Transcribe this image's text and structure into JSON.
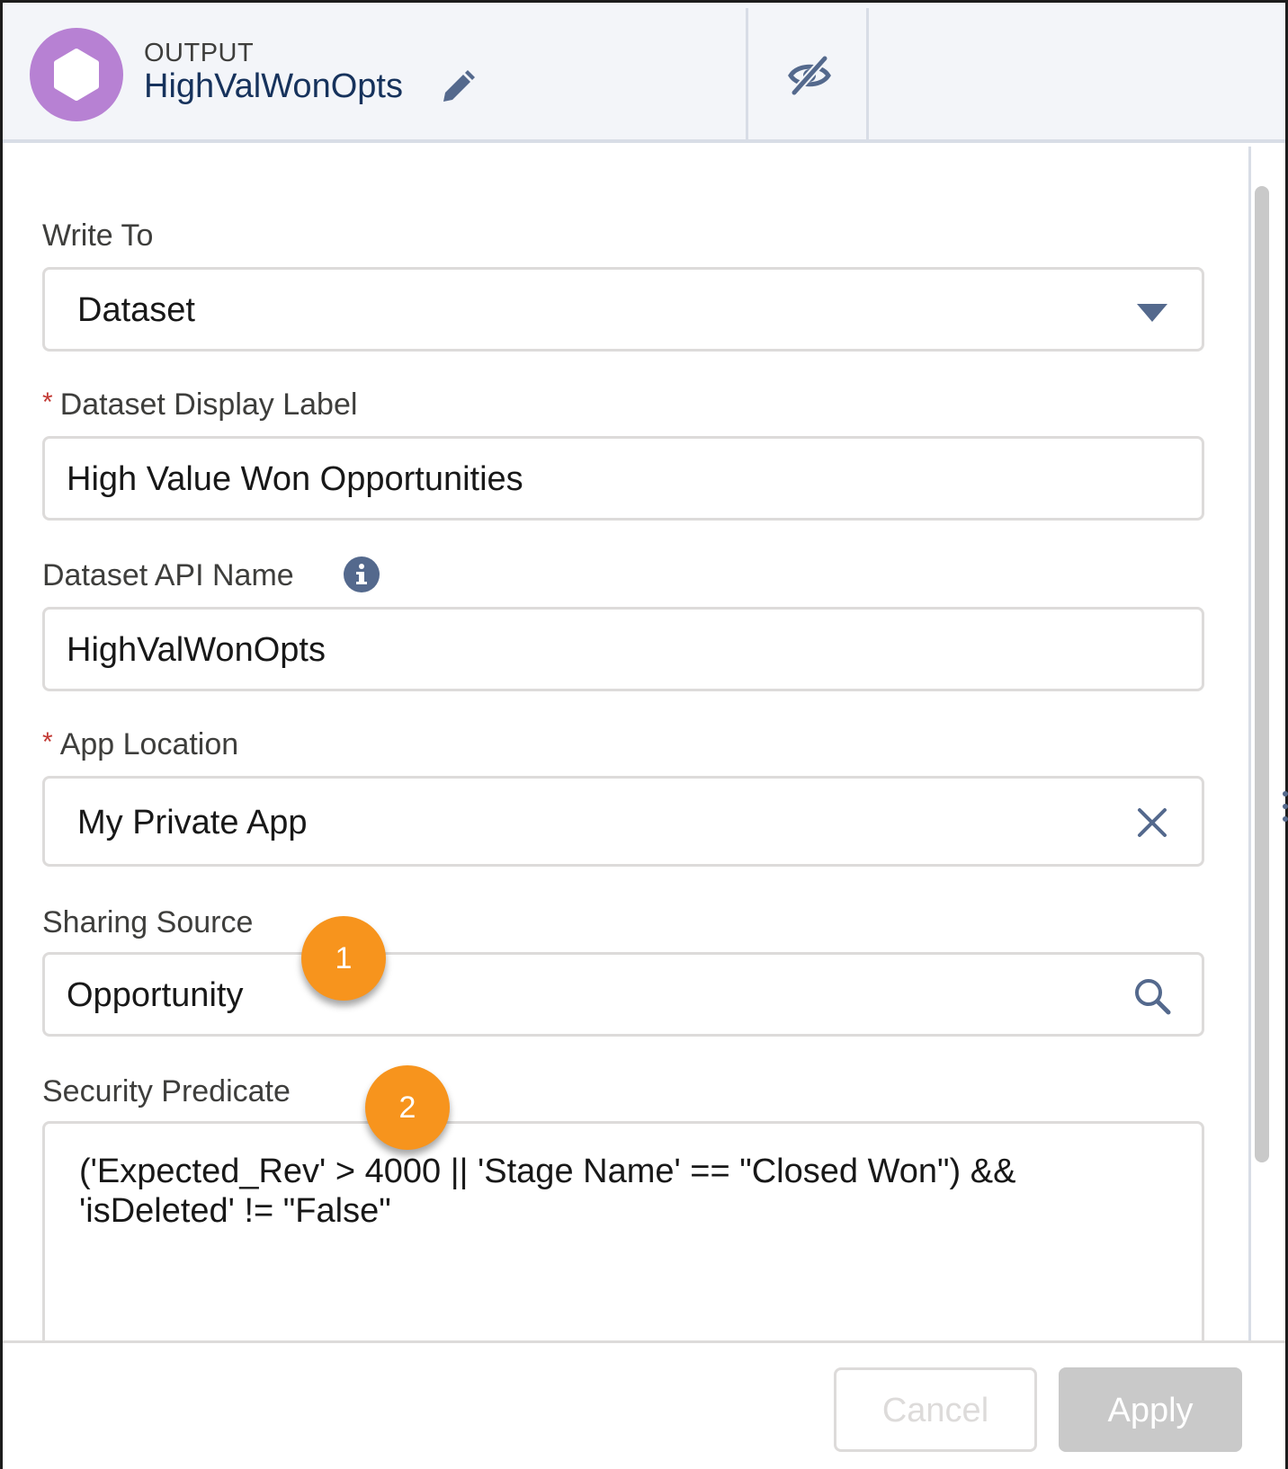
{
  "header": {
    "node_type": "OUTPUT",
    "node_name": "HighValWonOpts",
    "icon": "hexagon-icon",
    "edit_icon": "pencil-icon",
    "visibility_icon": "eye-hidden-icon",
    "icon_color": "#b781d3"
  },
  "form": {
    "write_to": {
      "label": "Write To",
      "value": "Dataset",
      "icon": "chevron-down-icon"
    },
    "display_label": {
      "label": "Dataset Display Label",
      "required_mark": "*",
      "value": "High Value Won Opportunities"
    },
    "api_name": {
      "label": "Dataset API Name",
      "value": "HighValWonOpts",
      "info_icon": "info-icon"
    },
    "app_location": {
      "label": "App Location",
      "required_mark": "*",
      "value": "My Private App",
      "icon": "close-icon"
    },
    "sharing_source": {
      "label": "Sharing Source",
      "value": "Opportunity",
      "icon": "search-icon"
    },
    "security_predicate": {
      "label": "Security Predicate",
      "lines": [
        "('Expected_Rev' > 4000 || 'Stage Name' == \"Closed Won\") &&",
        "'isDeleted' != \"False\""
      ]
    }
  },
  "callouts": [
    "1",
    "2"
  ],
  "footer": {
    "cancel_label": "Cancel",
    "apply_label": "Apply"
  },
  "colors": {
    "callout": "#f7941d",
    "required": "#c23934",
    "header_bg": "#f3f5f9"
  }
}
